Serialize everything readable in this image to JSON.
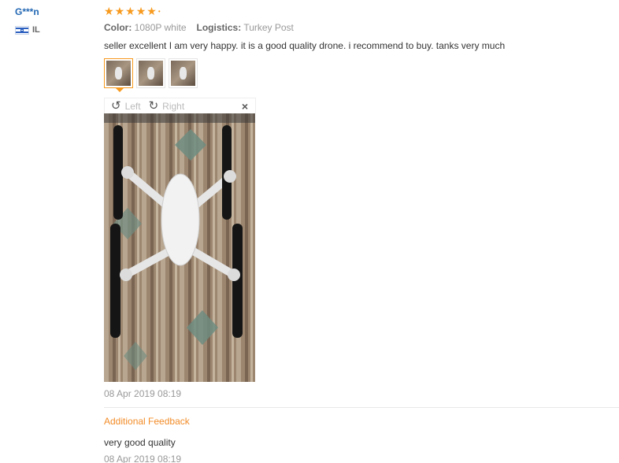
{
  "user": {
    "name": "G***n",
    "country": "IL"
  },
  "review": {
    "rating": 5,
    "attributes": [
      {
        "key": "Color:",
        "value": "1080P white"
      },
      {
        "key": "Logistics:",
        "value": "Turkey Post"
      }
    ],
    "text": "seller excellent I am very happy. it is a good quality drone. i recommend to buy. tanks very much",
    "thumbnails": [
      "photo-1",
      "photo-2",
      "photo-3"
    ],
    "viewer": {
      "left_label": "Left",
      "right_label": "Right"
    },
    "date": "08 Apr 2019 08:19"
  },
  "additional": {
    "title": "Additional Feedback",
    "text": "very good quality",
    "date": "08 Apr 2019 08:19"
  },
  "colors": {
    "accent": "#f79a1e",
    "link": "#2167b3"
  }
}
